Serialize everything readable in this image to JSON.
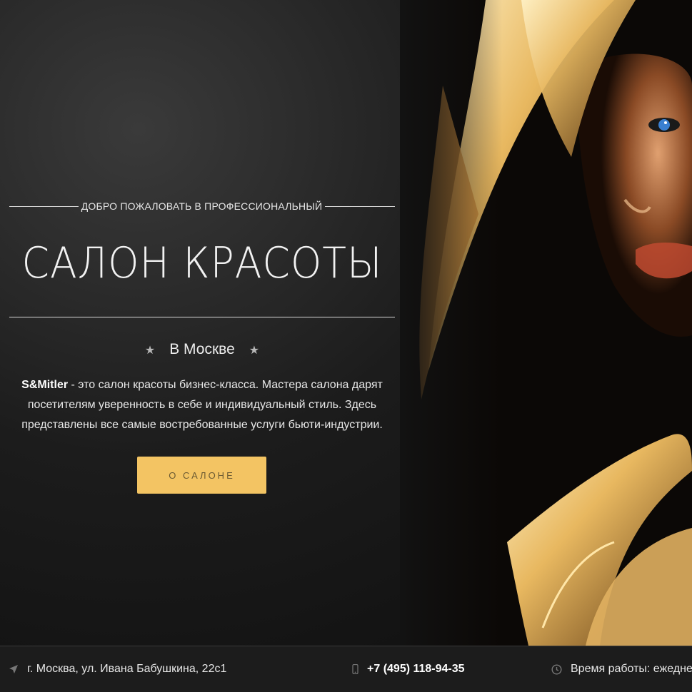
{
  "hero": {
    "welcome": "ДОБРО ПОЖАЛОВАТЬ В ПРОФЕССИОНАЛЬНЫЙ",
    "title": "САЛОН КРАСОТЫ",
    "city": "В Москве",
    "star_icon": "star-icon",
    "desc_brand": "S&Mitler",
    "desc_text": " - это салон красоты бизнес-класса. Мастера салона дарят посетителям уверенность в себе и индивидуальный стиль. Здесь представлены все самые востребованные услуги бьюти-индустрии.",
    "button_label": "О САЛОНЕ",
    "accent_color": "#f3c463"
  },
  "footer": {
    "address": "г. Москва, ул. Ивана Бабушкина, 22с1",
    "address_icon": "location-arrow-icon",
    "phone": "+7 (495) 118-94-35",
    "phone_icon": "mobile-phone-icon",
    "hours": "Время работы: ежедне",
    "hours_icon": "clock-icon"
  }
}
